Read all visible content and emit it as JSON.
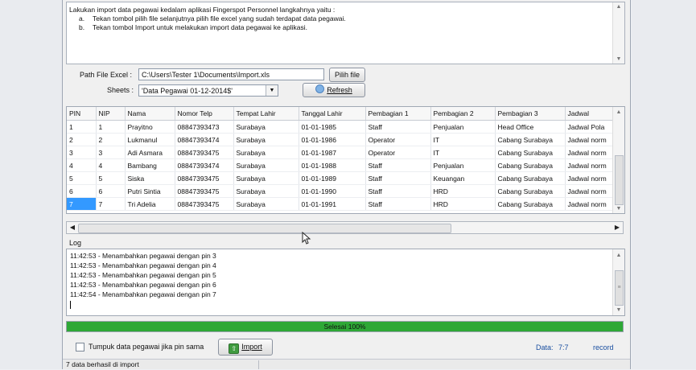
{
  "instructions": {
    "line1": "Lakukan import data pegawai kedalam aplikasi Fingerspot Personnel langkahnya yaitu :",
    "step_a_marker": "a.",
    "step_a": "Tekan tombol pilih file selanjutnya pilih file excel yang sudah terdapat data pegawai.",
    "step_b_marker": "b.",
    "step_b": "Tekan tombol Import untuk melakukan import data pegawai ke aplikasi."
  },
  "form": {
    "path_label": "Path File Excel :",
    "path_value": "C:\\Users\\Tester 1\\Documents\\Import.xls",
    "pick_file_label": "Pilih file",
    "sheets_label": "Sheets :",
    "sheets_value": "'Data Pegawai 01-12-2014$'",
    "refresh_label": "Refresh"
  },
  "table": {
    "columns": [
      "PIN",
      "NIP",
      "Nama",
      "Nomor Telp",
      "Tempat Lahir",
      "Tanggal Lahir",
      "Pembagian 1",
      "Pembagian 2",
      "Pembagian 3",
      "Jadwal"
    ],
    "rows": [
      [
        "1",
        "1",
        "Prayitno",
        "08847393473",
        "Surabaya",
        "01-01-1985",
        "Staff",
        "Penjualan",
        "Head Office",
        "Jadwal Pola"
      ],
      [
        "2",
        "2",
        "Lukmanul",
        "08847393474",
        "Surabaya",
        "01-01-1986",
        "Operator",
        "IT",
        "Cabang Surabaya",
        "Jadwal norm"
      ],
      [
        "3",
        "3",
        "Adi Asmara",
        "08847393475",
        "Surabaya",
        "01-01-1987",
        "Operator",
        "IT",
        "Cabang Surabaya",
        "Jadwal norm"
      ],
      [
        "4",
        "4",
        "Bambang",
        "08847393474",
        "Surabaya",
        "01-01-1988",
        "Staff",
        "Penjualan",
        "Cabang Surabaya",
        "Jadwal norm"
      ],
      [
        "5",
        "5",
        "Siska",
        "08847393475",
        "Surabaya",
        "01-01-1989",
        "Staff",
        "Keuangan",
        "Cabang Surabaya",
        "Jadwal norm"
      ],
      [
        "6",
        "6",
        "Putri Sintia",
        "08847393475",
        "Surabaya",
        "01-01-1990",
        "Staff",
        "HRD",
        "Cabang Surabaya",
        "Jadwal norm"
      ],
      [
        "7",
        "7",
        "Tri Adelia",
        "08847393475",
        "Surabaya",
        "01-01-1991",
        "Staff",
        "HRD",
        "Cabang Surabaya",
        "Jadwal norm"
      ]
    ]
  },
  "log": {
    "label": "Log",
    "lines": [
      "11:42:53 - Menambahkan pegawai dengan pin 3",
      "11:42:53 - Menambahkan pegawai dengan pin 4",
      "11:42:53 - Menambahkan pegawai dengan pin 5",
      "11:42:53 - Menambahkan pegawai dengan pin 6",
      "11:42:54 - Menambahkan pegawai dengan pin 7"
    ]
  },
  "progress": {
    "text": "Selesai 100%",
    "fraction": 1.0,
    "color": "#2ea836"
  },
  "bottom": {
    "stack_checkbox_label": "Tumpuk data pegawai jika pin sama",
    "import_label": "Import",
    "data_label": "Data:",
    "data_value": "7:7",
    "record_label": "record"
  },
  "status": {
    "text": "7 data berhasil di import"
  },
  "colors": {
    "selection": "#3399ff",
    "info_text": "#1a4fa0"
  }
}
